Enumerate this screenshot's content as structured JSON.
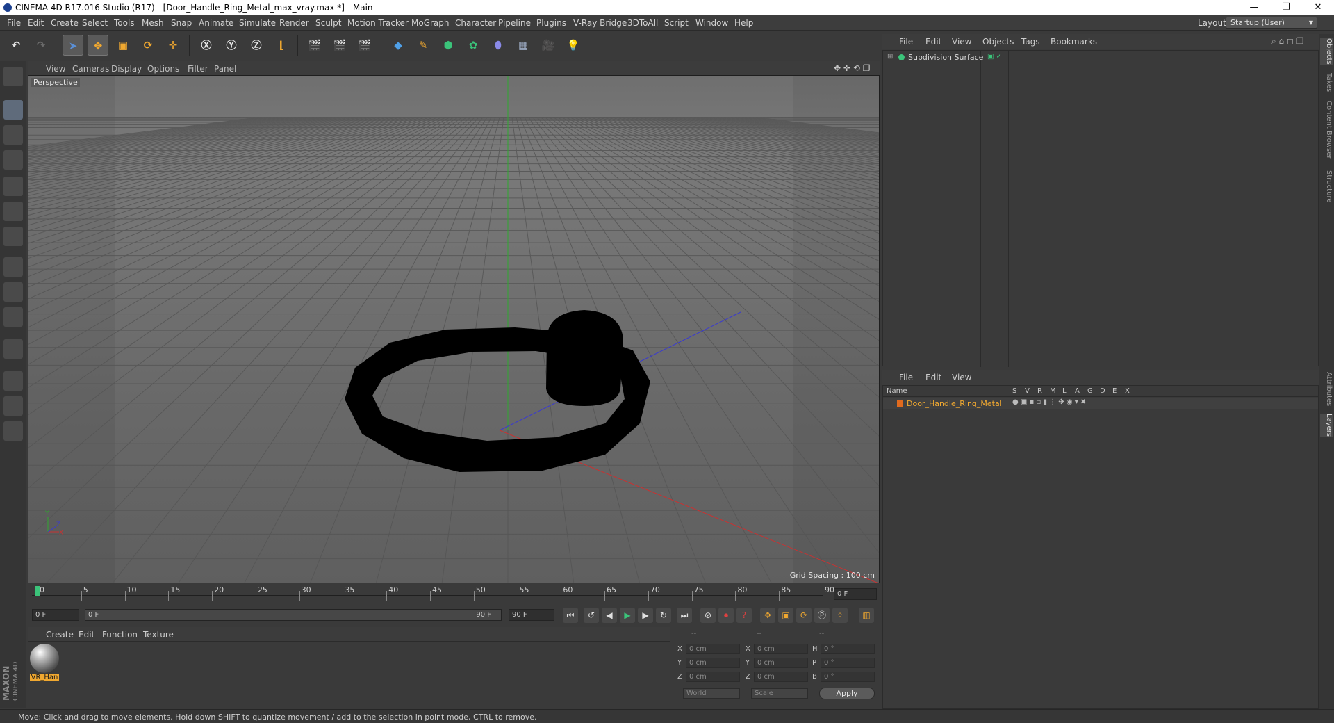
{
  "window": {
    "title": "CINEMA 4D R17.016 Studio (R17) - [Door_Handle_Ring_Metal_max_vray.max *] - Main",
    "minimize": "—",
    "restore": "❐",
    "close": "✕"
  },
  "menubar": {
    "items": [
      "File",
      "Edit",
      "Create",
      "Select",
      "Tools",
      "Mesh",
      "Snap",
      "Animate",
      "Simulate",
      "Render",
      "Sculpt",
      "Motion Tracker",
      "MoGraph",
      "Character",
      "Pipeline",
      "Plugins",
      "V-Ray Bridge",
      "3DToAll",
      "Script",
      "Window",
      "Help"
    ],
    "layout_label": "Layout:",
    "layout_value": "Startup (User)"
  },
  "viewport": {
    "menu": [
      "View",
      "Cameras",
      "Display",
      "Options",
      "Filter",
      "Panel"
    ],
    "label": "Perspective",
    "grid_spacing": "Grid Spacing : 100 cm",
    "axis_labels": {
      "y": "Y",
      "x": "X",
      "z": "Z"
    }
  },
  "timeline": {
    "ticks": [
      "0",
      "5",
      "10",
      "15",
      "20",
      "25",
      "30",
      "35",
      "40",
      "45",
      "50",
      "55",
      "60",
      "65",
      "70",
      "75",
      "80",
      "85",
      "90"
    ],
    "current_frame_field": "0 F",
    "start_field": "0 F",
    "range_start": "0 F",
    "range_end": "90 F",
    "end_field": "90 F"
  },
  "material_manager": {
    "menu": [
      "Create",
      "Edit",
      "Function",
      "Texture"
    ],
    "materials": [
      {
        "name": "VR_Han"
      }
    ]
  },
  "coordinates": {
    "headers": [
      "--",
      "--",
      "--"
    ],
    "rows": [
      {
        "a": "X",
        "av": "0 cm",
        "b": "X",
        "bv": "0 cm",
        "c": "H",
        "cv": "0 °"
      },
      {
        "a": "Y",
        "av": "0 cm",
        "b": "Y",
        "bv": "0 cm",
        "c": "P",
        "cv": "0 °"
      },
      {
        "a": "Z",
        "av": "0 cm",
        "b": "Z",
        "bv": "0 cm",
        "c": "B",
        "cv": "0 °"
      }
    ],
    "world_select": "World",
    "scale_select": "Scale",
    "apply": "Apply"
  },
  "object_manager": {
    "menu": [
      "File",
      "Edit",
      "View",
      "Objects",
      "Tags",
      "Bookmarks"
    ],
    "objects": [
      {
        "name": "Subdivision Surface"
      }
    ]
  },
  "layer_manager": {
    "menu": [
      "File",
      "Edit",
      "View"
    ],
    "columns": [
      "Name",
      "S",
      "V",
      "R",
      "M",
      "L",
      "A",
      "G",
      "D",
      "E",
      "X"
    ],
    "layers": [
      {
        "name": "Door_Handle_Ring_Metal",
        "color": "#e06a1e"
      }
    ]
  },
  "side_tabs": [
    "Objects",
    "Takes",
    "Content Browser",
    "Structure",
    "Attributes",
    "Layers"
  ],
  "branding": {
    "maxon": "MAXON",
    "c4d": "CINEMA 4D"
  },
  "status": "Move: Click and drag to move elements. Hold down SHIFT to quantize movement / add to the selection in point mode, CTRL to remove.",
  "colors": {
    "accent": "#5a8fd6",
    "layer_orange": "#e06a1e",
    "x_axis": "#c83232",
    "y_axis": "#2fa82f",
    "z_axis": "#3a3ad0"
  }
}
